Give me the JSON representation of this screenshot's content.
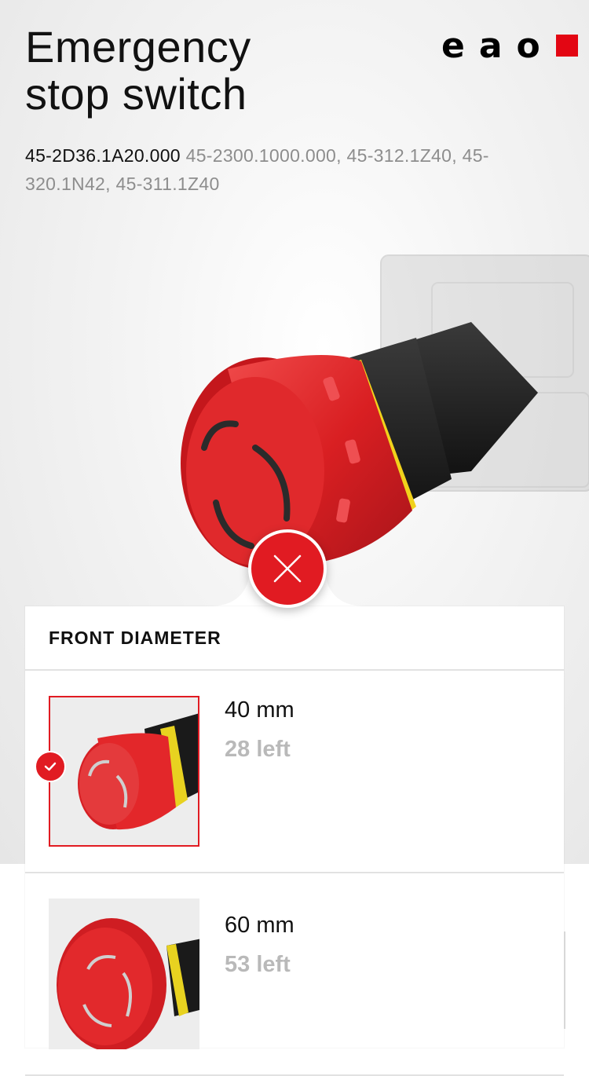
{
  "product": {
    "title_line1": "Emergency",
    "title_line2": "stop switch",
    "primary_code": "45-2D36.1A20.000",
    "other_codes": " 45-2300.1000.000, 45-312.1Z40, 45-320.1N42, 45-311.1Z40"
  },
  "brand": {
    "logo_letters": [
      "e",
      "a",
      "o"
    ],
    "accent_color": "#e30613"
  },
  "panel": {
    "header": "FRONT DIAMETER",
    "options": [
      {
        "size": "40 mm",
        "stock": "28 left",
        "selected": true
      },
      {
        "size": "60 mm",
        "stock": "53 left",
        "selected": false
      }
    ]
  },
  "icons": {
    "close": "close-icon",
    "check": "check-icon"
  }
}
